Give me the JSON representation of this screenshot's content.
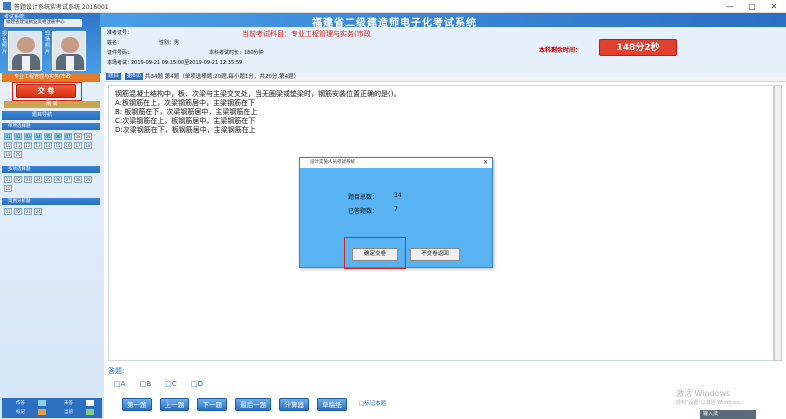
{
  "window": {
    "title": "答题设计系统实考试系统 2016001",
    "minimize": "—",
    "maximize": "□",
    "close": "✕"
  },
  "header": {
    "system": "考试系统:",
    "org": "福建省建设执业资格注册中心",
    "photo_label_left": "报名照片",
    "photo_label_right": "现场照片",
    "banner": "福建省二级建造师电子化考试系统"
  },
  "candidate": {
    "exam_no_label": "准考证号：",
    "name_label": "姓名：",
    "gender_label": "性别：男",
    "id_label": "证件号码：",
    "duration_label": "本科考试时长：180分钟",
    "exam_time_label": "本场考试：",
    "exam_time_value": "2019-09-21 09:15:00至2019-09-21 12:35:59",
    "subject": "当前考试科目：专业工程管理与实务(市政",
    "remain_label": "本科剩余时间：",
    "remain_value": "148分2秒"
  },
  "left": {
    "subject_tab": "专业工程管理与实务(市政",
    "submit_button": "交 卷",
    "sep_label": "刷 新",
    "nav_title": "题目导航",
    "sections": [
      {
        "title": "单项选择题",
        "items": [
          "01",
          "02",
          "03",
          "04",
          "05",
          "06",
          "07",
          "08",
          "09",
          "10",
          "11",
          "12",
          "13",
          "14",
          "15",
          "16",
          "17",
          "18",
          "19",
          "20"
        ],
        "done": [
          "01",
          "02",
          "03",
          "04",
          "05",
          "06",
          "07"
        ]
      },
      {
        "title": "多项选择题",
        "items": [
          "01",
          "02",
          "03",
          "04",
          "05",
          "06",
          "07",
          "08",
          "09",
          "10"
        ],
        "done": []
      },
      {
        "title": "案例分析题",
        "items": [
          "01",
          "02",
          "03",
          "04"
        ],
        "done": []
      }
    ],
    "legend": {
      "done": "作答",
      "undone": "未答",
      "marked": "标记",
      "current": "当前"
    }
  },
  "question": {
    "prev_tag": "题目",
    "cur_tag": "第6页",
    "summary": "共34题  第4题（单项选择题:20题,每小题1分，共20分,第4题）",
    "text": "钢筋混凝土结构中，板、次梁与主梁交叉处，当无圈梁或垫梁时，钢筋安装位置正确的是()。",
    "options": [
      "A:板钢筋在上，次梁钢筋居中，主梁钢筋在下",
      "B: 板钢筋在下，次梁钢筋居中，主梁钢筋在上",
      "C:次梁钢筋在上，板钢筋居中，主梁钢筋在下",
      "D:次梁钢筋在下，板钢筋居中，主梁钢筋在上"
    ]
  },
  "answer": {
    "label": "答题:",
    "choices": [
      "□A",
      "□B",
      "□C",
      "□D"
    ]
  },
  "nav_buttons": {
    "first": "第一题",
    "prev": "上一题",
    "next": "下一题",
    "last": "最后一题",
    "calc": "计算器",
    "draft": "草稿纸",
    "mark": "□标记本题"
  },
  "dialog": {
    "title": "设计实施人员考试系统",
    "close": "✕",
    "total_label": "题目总数：",
    "total_value": "34",
    "answered_label": "已答题数：",
    "answered_value": "7",
    "confirm": "确定交卷",
    "cancel": "不交卷返回"
  },
  "watermark": {
    "line1": "激活 Windows",
    "line2": "转到\"设置\"以激活 Windows。",
    "taskbar": "输入法"
  }
}
